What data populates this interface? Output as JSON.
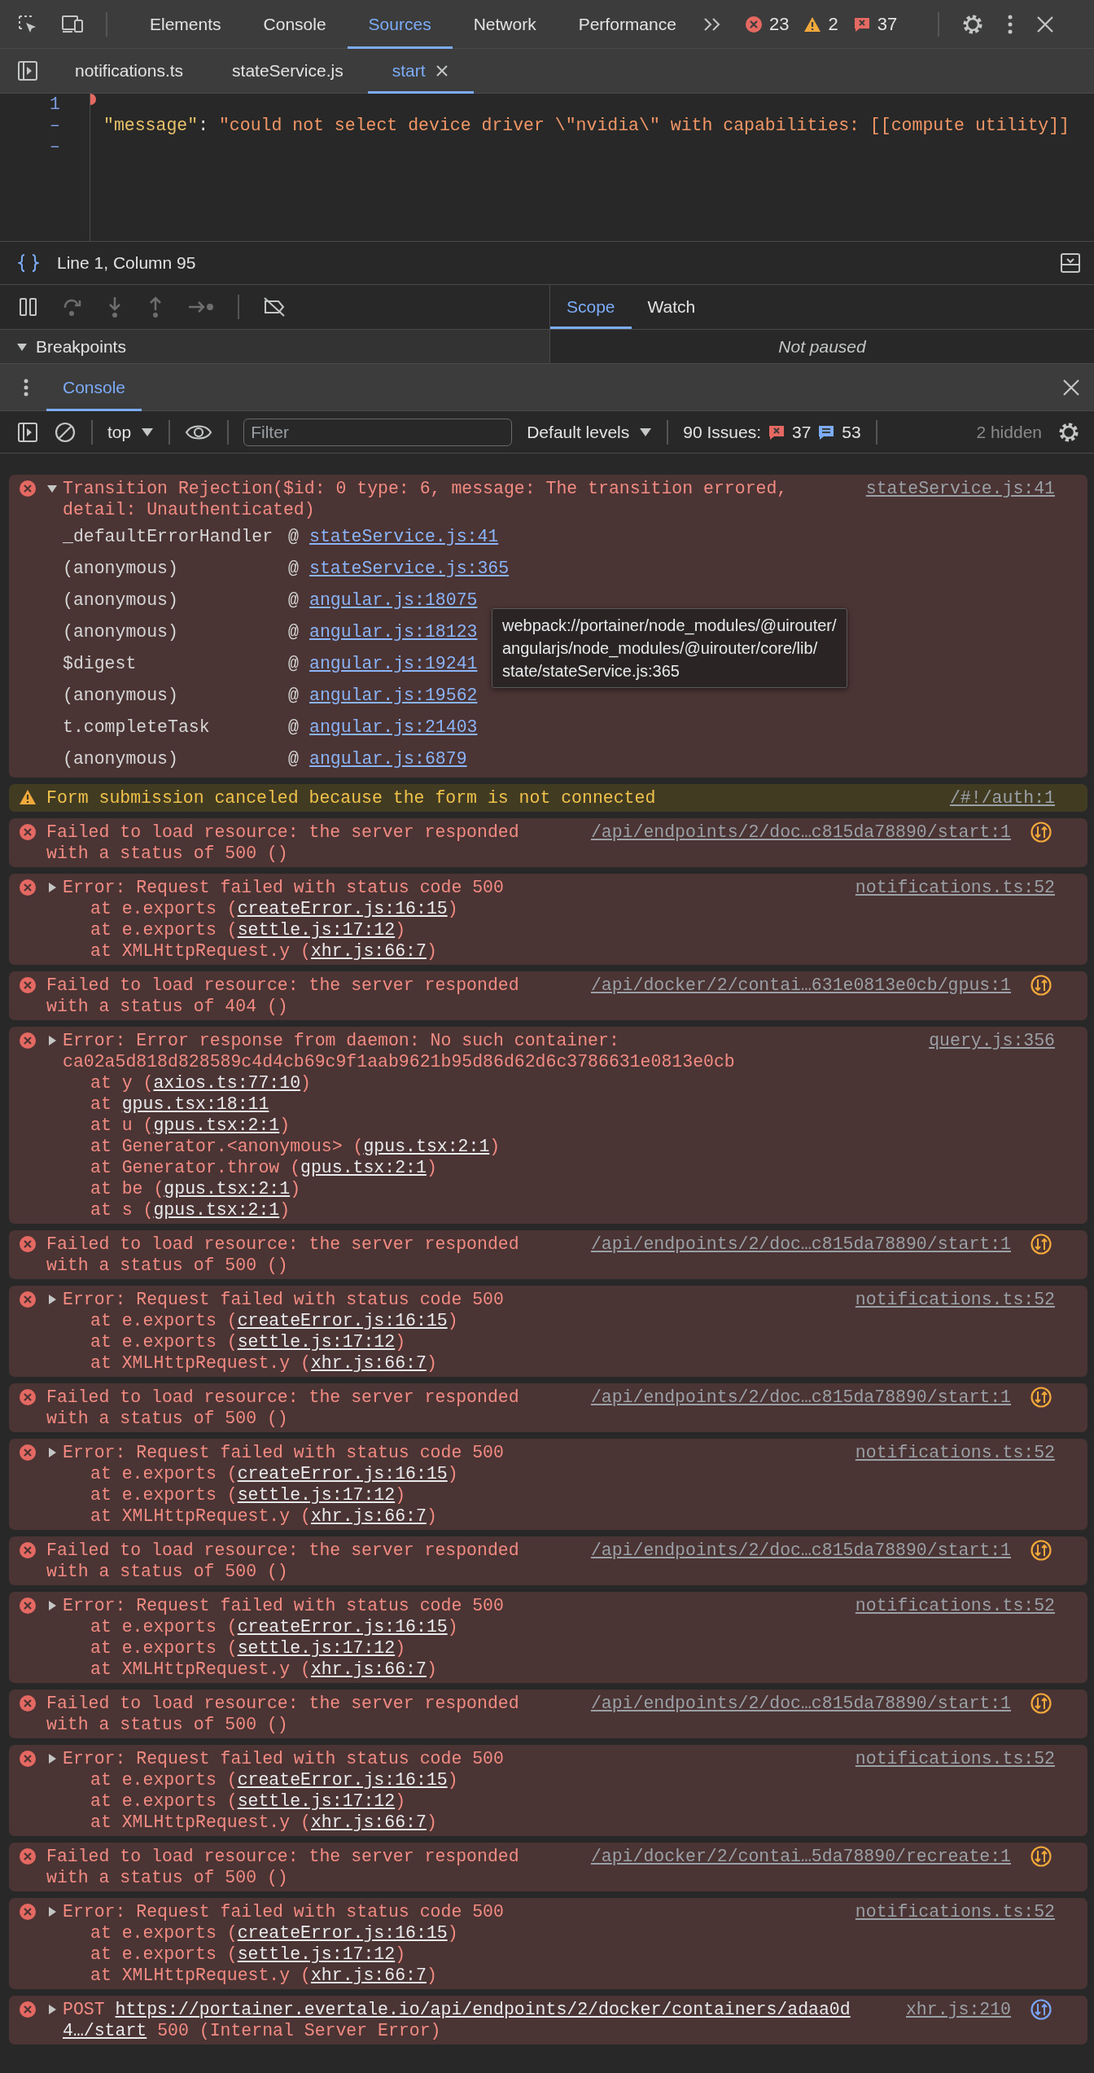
{
  "toolbar": {
    "tabs": [
      {
        "label": "Elements",
        "selected": false
      },
      {
        "label": "Console",
        "selected": false
      },
      {
        "label": "Sources",
        "selected": true
      },
      {
        "label": "Network",
        "selected": false
      },
      {
        "label": "Performance",
        "selected": false
      }
    ],
    "error_count": "23",
    "warning_count": "2",
    "issue_count": "37"
  },
  "file_tabs": [
    {
      "label": "notifications.ts",
      "selected": false,
      "closable": false
    },
    {
      "label": "stateService.js",
      "selected": false,
      "closable": false
    },
    {
      "label": "start",
      "selected": true,
      "closable": true
    }
  ],
  "editor": {
    "gutter": [
      "1",
      "–",
      "–"
    ],
    "code_line": {
      "key": "\"message\"",
      "separator": ": ",
      "value": "\"could not select device driver \\\"nvidia\\\" with capabilities: [[compute utility]]"
    }
  },
  "status": {
    "position": "Line 1, Column 95"
  },
  "debugger": {
    "tabs": [
      {
        "label": "Scope",
        "selected": true
      },
      {
        "label": "Watch",
        "selected": false
      }
    ],
    "breakpoints": {
      "label": "Breakpoints",
      "expanded": true
    },
    "scope_message": "Not paused"
  },
  "drawer": {
    "tabs": [
      {
        "label": "Console",
        "selected": true
      }
    ]
  },
  "console_toolbar": {
    "context": "top",
    "filter": {
      "placeholder": "Filter"
    },
    "levels": "Default levels",
    "issues_label": "90 Issues:",
    "issue_errors": "37",
    "issue_infos": "53",
    "hidden": "2 hidden"
  },
  "messages": [
    {
      "kind": "trace",
      "expanded": true,
      "text": "Transition Rejection($id: 0 type: 6, message: The transition errored, detail: Unauthenticated)",
      "source": "stateService.js:41",
      "frames": [
        {
          "function": "_defaultErrorHandler",
          "at": "@",
          "location": "stateService.js:41"
        },
        {
          "function": "(anonymous)",
          "at": "@",
          "location": "stateService.js:365"
        },
        {
          "function": "(anonymous)",
          "at": "@",
          "location": "angular.js:18075"
        },
        {
          "function": "(anonymous)",
          "at": "@",
          "location": "angular.js:18123"
        },
        {
          "function": "$digest",
          "at": "@",
          "location": "angular.js:19241"
        },
        {
          "function": "(anonymous)",
          "at": "@",
          "location": "angular.js:19562"
        },
        {
          "function": "t.completeTask",
          "at": "@",
          "location": "angular.js:21403"
        },
        {
          "function": "(anonymous)",
          "at": "@",
          "location": "angular.js:6879"
        }
      ],
      "tooltip": [
        "webpack://portainer/node_modules/@uirouter/",
        "angularjs/node_modules/@uirouter/core/lib/",
        "state/stateService.js:365"
      ]
    },
    {
      "kind": "warning",
      "text": "Form submission canceled because the form is not connected",
      "source": "/#!/auth:1"
    },
    {
      "kind": "network",
      "text": "Failed to load resource: the server responded with a status of 500 ()",
      "source": "/api/endpoints/2/doc…c815da78890/start:1",
      "color": "#f2a93b"
    },
    {
      "kind": "error",
      "expanded": false,
      "text": "Error: Request failed with status code 500",
      "source": "notifications.ts:52",
      "stack": [
        {
          "before": "at e.exports (",
          "link": "createError.js:16:15",
          "after": ")"
        },
        {
          "before": "at e.exports (",
          "link": "settle.js:17:12",
          "after": ")"
        },
        {
          "before": "at XMLHttpRequest.y (",
          "link": "xhr.js:66:7",
          "after": ")"
        }
      ]
    },
    {
      "kind": "network",
      "text": "Failed to load resource: the server responded with a status of 404 ()",
      "source": "/api/docker/2/contai…631e0813e0cb/gpus:1",
      "color": "#f2a93b"
    },
    {
      "kind": "error",
      "expanded": false,
      "text": "Error: Error response from daemon: No such container: ca02a5d818d828589c4d4cb69c9f1aab9621b95d86d62d6c3786631e0813e0cb",
      "source": "query.js:356",
      "stack": [
        {
          "before": "at y (",
          "link": "axios.ts:77:10",
          "after": ")"
        },
        {
          "before": "at ",
          "link": "gpus.tsx:18:11"
        },
        {
          "before": "at u (",
          "link": "gpus.tsx:2:1",
          "after": ")"
        },
        {
          "before": "at Generator.<anonymous> (",
          "link": "gpus.tsx:2:1",
          "after": ")"
        },
        {
          "before": "at Generator.throw (",
          "link": "gpus.tsx:2:1",
          "after": ")"
        },
        {
          "before": "at be (",
          "link": "gpus.tsx:2:1",
          "after": ")"
        },
        {
          "before": "at s (",
          "link": "gpus.tsx:2:1",
          "after": ")"
        }
      ]
    },
    {
      "kind": "network",
      "text": "Failed to load resource: the server responded with a status of 500 ()",
      "source": "/api/endpoints/2/doc…c815da78890/start:1",
      "color": "#f2a93b"
    },
    {
      "kind": "error",
      "expanded": false,
      "text": "Error: Request failed with status code 500",
      "source": "notifications.ts:52",
      "stack": [
        {
          "before": "at e.exports (",
          "link": "createError.js:16:15",
          "after": ")"
        },
        {
          "before": "at e.exports (",
          "link": "settle.js:17:12",
          "after": ")"
        },
        {
          "before": "at XMLHttpRequest.y (",
          "link": "xhr.js:66:7",
          "after": ")"
        }
      ]
    },
    {
      "kind": "network",
      "text": "Failed to load resource: the server responded with a status of 500 ()",
      "source": "/api/endpoints/2/doc…c815da78890/start:1",
      "color": "#f2a93b"
    },
    {
      "kind": "error",
      "expanded": false,
      "text": "Error: Request failed with status code 500",
      "source": "notifications.ts:52",
      "stack": [
        {
          "before": "at e.exports (",
          "link": "createError.js:16:15",
          "after": ")"
        },
        {
          "before": "at e.exports (",
          "link": "settle.js:17:12",
          "after": ")"
        },
        {
          "before": "at XMLHttpRequest.y (",
          "link": "xhr.js:66:7",
          "after": ")"
        }
      ]
    },
    {
      "kind": "network",
      "text": "Failed to load resource: the server responded with a status of 500 ()",
      "source": "/api/endpoints/2/doc…c815da78890/start:1",
      "color": "#f2a93b"
    },
    {
      "kind": "error",
      "expanded": false,
      "text": "Error: Request failed with status code 500",
      "source": "notifications.ts:52",
      "stack": [
        {
          "before": "at e.exports (",
          "link": "createError.js:16:15",
          "after": ")"
        },
        {
          "before": "at e.exports (",
          "link": "settle.js:17:12",
          "after": ")"
        },
        {
          "before": "at XMLHttpRequest.y (",
          "link": "xhr.js:66:7",
          "after": ")"
        }
      ]
    },
    {
      "kind": "network",
      "text": "Failed to load resource: the server responded with a status of 500 ()",
      "source": "/api/endpoints/2/doc…c815da78890/start:1",
      "color": "#f2a93b"
    },
    {
      "kind": "error",
      "expanded": false,
      "text": "Error: Request failed with status code 500",
      "source": "notifications.ts:52",
      "stack": [
        {
          "before": "at e.exports (",
          "link": "createError.js:16:15",
          "after": ")"
        },
        {
          "before": "at e.exports (",
          "link": "settle.js:17:12",
          "after": ")"
        },
        {
          "before": "at XMLHttpRequest.y (",
          "link": "xhr.js:66:7",
          "after": ")"
        }
      ]
    },
    {
      "kind": "network",
      "text": "Failed to load resource: the server responded with a status of 500 ()",
      "source": "/api/docker/2/contai…5da78890/recreate:1",
      "color": "#f2a93b"
    },
    {
      "kind": "error",
      "expanded": false,
      "text": "Error: Request failed with status code 500",
      "source": "notifications.ts:52",
      "stack": [
        {
          "before": "at e.exports (",
          "link": "createError.js:16:15",
          "after": ")"
        },
        {
          "before": "at e.exports (",
          "link": "settle.js:17:12",
          "after": ")"
        },
        {
          "before": "at XMLHttpRequest.y (",
          "link": "xhr.js:66:7",
          "after": ")"
        }
      ]
    },
    {
      "kind": "request",
      "expanded": false,
      "method": "POST",
      "url": "https://portainer.evertale.io/api/endpoints/2/docker/containers/adaa0d4…/start",
      "status": "500 (Internal Server Error)",
      "source": "xhr.js:210",
      "color": "#7aa5f5"
    }
  ]
}
